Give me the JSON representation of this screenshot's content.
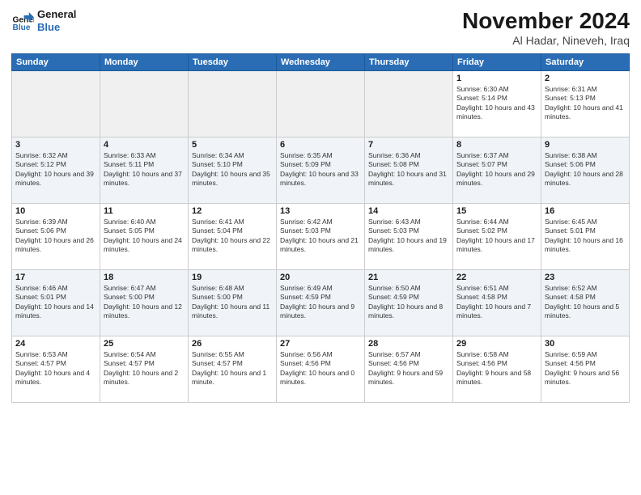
{
  "logo": {
    "line1": "General",
    "line2": "Blue"
  },
  "title": "November 2024",
  "location": "Al Hadar, Nineveh, Iraq",
  "weekdays": [
    "Sunday",
    "Monday",
    "Tuesday",
    "Wednesday",
    "Thursday",
    "Friday",
    "Saturday"
  ],
  "weeks": [
    [
      {
        "day": "",
        "info": ""
      },
      {
        "day": "",
        "info": ""
      },
      {
        "day": "",
        "info": ""
      },
      {
        "day": "",
        "info": ""
      },
      {
        "day": "",
        "info": ""
      },
      {
        "day": "1",
        "info": "Sunrise: 6:30 AM\nSunset: 5:14 PM\nDaylight: 10 hours and 43 minutes."
      },
      {
        "day": "2",
        "info": "Sunrise: 6:31 AM\nSunset: 5:13 PM\nDaylight: 10 hours and 41 minutes."
      }
    ],
    [
      {
        "day": "3",
        "info": "Sunrise: 6:32 AM\nSunset: 5:12 PM\nDaylight: 10 hours and 39 minutes."
      },
      {
        "day": "4",
        "info": "Sunrise: 6:33 AM\nSunset: 5:11 PM\nDaylight: 10 hours and 37 minutes."
      },
      {
        "day": "5",
        "info": "Sunrise: 6:34 AM\nSunset: 5:10 PM\nDaylight: 10 hours and 35 minutes."
      },
      {
        "day": "6",
        "info": "Sunrise: 6:35 AM\nSunset: 5:09 PM\nDaylight: 10 hours and 33 minutes."
      },
      {
        "day": "7",
        "info": "Sunrise: 6:36 AM\nSunset: 5:08 PM\nDaylight: 10 hours and 31 minutes."
      },
      {
        "day": "8",
        "info": "Sunrise: 6:37 AM\nSunset: 5:07 PM\nDaylight: 10 hours and 29 minutes."
      },
      {
        "day": "9",
        "info": "Sunrise: 6:38 AM\nSunset: 5:06 PM\nDaylight: 10 hours and 28 minutes."
      }
    ],
    [
      {
        "day": "10",
        "info": "Sunrise: 6:39 AM\nSunset: 5:06 PM\nDaylight: 10 hours and 26 minutes."
      },
      {
        "day": "11",
        "info": "Sunrise: 6:40 AM\nSunset: 5:05 PM\nDaylight: 10 hours and 24 minutes."
      },
      {
        "day": "12",
        "info": "Sunrise: 6:41 AM\nSunset: 5:04 PM\nDaylight: 10 hours and 22 minutes."
      },
      {
        "day": "13",
        "info": "Sunrise: 6:42 AM\nSunset: 5:03 PM\nDaylight: 10 hours and 21 minutes."
      },
      {
        "day": "14",
        "info": "Sunrise: 6:43 AM\nSunset: 5:03 PM\nDaylight: 10 hours and 19 minutes."
      },
      {
        "day": "15",
        "info": "Sunrise: 6:44 AM\nSunset: 5:02 PM\nDaylight: 10 hours and 17 minutes."
      },
      {
        "day": "16",
        "info": "Sunrise: 6:45 AM\nSunset: 5:01 PM\nDaylight: 10 hours and 16 minutes."
      }
    ],
    [
      {
        "day": "17",
        "info": "Sunrise: 6:46 AM\nSunset: 5:01 PM\nDaylight: 10 hours and 14 minutes."
      },
      {
        "day": "18",
        "info": "Sunrise: 6:47 AM\nSunset: 5:00 PM\nDaylight: 10 hours and 12 minutes."
      },
      {
        "day": "19",
        "info": "Sunrise: 6:48 AM\nSunset: 5:00 PM\nDaylight: 10 hours and 11 minutes."
      },
      {
        "day": "20",
        "info": "Sunrise: 6:49 AM\nSunset: 4:59 PM\nDaylight: 10 hours and 9 minutes."
      },
      {
        "day": "21",
        "info": "Sunrise: 6:50 AM\nSunset: 4:59 PM\nDaylight: 10 hours and 8 minutes."
      },
      {
        "day": "22",
        "info": "Sunrise: 6:51 AM\nSunset: 4:58 PM\nDaylight: 10 hours and 7 minutes."
      },
      {
        "day": "23",
        "info": "Sunrise: 6:52 AM\nSunset: 4:58 PM\nDaylight: 10 hours and 5 minutes."
      }
    ],
    [
      {
        "day": "24",
        "info": "Sunrise: 6:53 AM\nSunset: 4:57 PM\nDaylight: 10 hours and 4 minutes."
      },
      {
        "day": "25",
        "info": "Sunrise: 6:54 AM\nSunset: 4:57 PM\nDaylight: 10 hours and 2 minutes."
      },
      {
        "day": "26",
        "info": "Sunrise: 6:55 AM\nSunset: 4:57 PM\nDaylight: 10 hours and 1 minute."
      },
      {
        "day": "27",
        "info": "Sunrise: 6:56 AM\nSunset: 4:56 PM\nDaylight: 10 hours and 0 minutes."
      },
      {
        "day": "28",
        "info": "Sunrise: 6:57 AM\nSunset: 4:56 PM\nDaylight: 9 hours and 59 minutes."
      },
      {
        "day": "29",
        "info": "Sunrise: 6:58 AM\nSunset: 4:56 PM\nDaylight: 9 hours and 58 minutes."
      },
      {
        "day": "30",
        "info": "Sunrise: 6:59 AM\nSunset: 4:56 PM\nDaylight: 9 hours and 56 minutes."
      }
    ]
  ]
}
